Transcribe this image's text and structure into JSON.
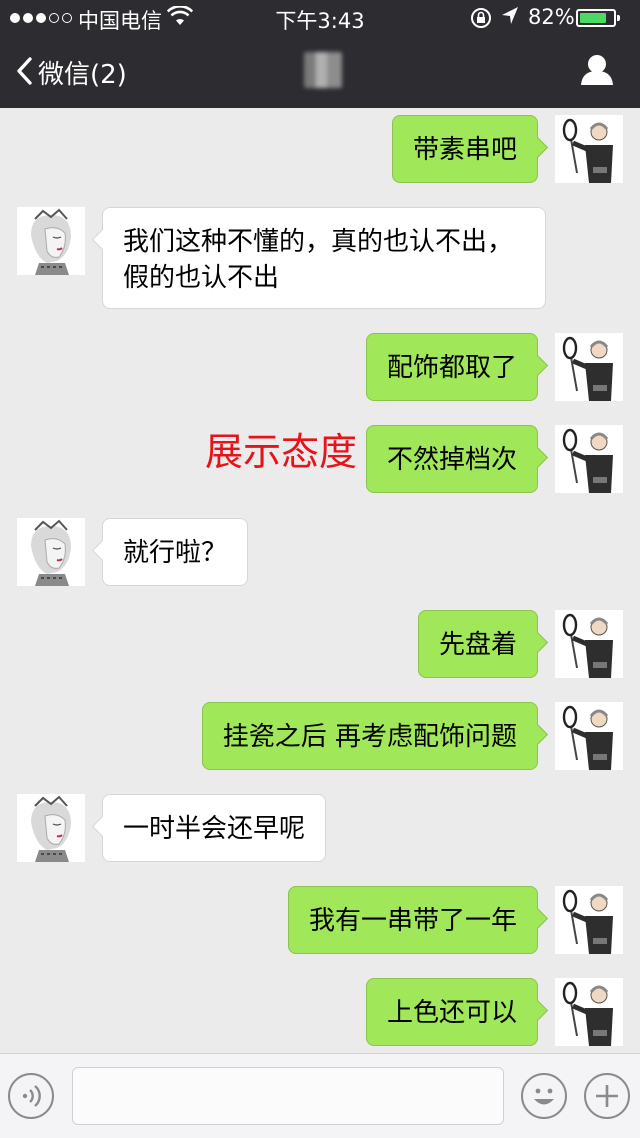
{
  "status_bar": {
    "carrier": "中国电信",
    "time": "下午3:43",
    "battery_percent": "82%",
    "battery_level": 0.82,
    "signal_dots_filled": 3,
    "signal_dots_total": 5
  },
  "nav": {
    "back_label": "微信(2)",
    "title": "",
    "profile_icon": "person-icon"
  },
  "colors": {
    "sent_bubble": "#a0e75a",
    "received_bubble": "#ffffff",
    "annotation": "#e6141a",
    "nav_background": "#2c2c31"
  },
  "messages": [
    {
      "side": "right",
      "text": "带素串吧"
    },
    {
      "side": "left",
      "text": "我们这种不懂的，真的也认不出，\n假的也认不出"
    },
    {
      "side": "right",
      "text": "配饰都取了"
    },
    {
      "side": "right",
      "text": "不然掉档次"
    },
    {
      "side": "left",
      "text": "就行啦？"
    },
    {
      "side": "right",
      "text": "先盘着"
    },
    {
      "side": "right",
      "text": "挂瓷之后 再考虑配饰问题"
    },
    {
      "side": "left",
      "text": "一时半会还早呢"
    },
    {
      "side": "right",
      "text": "我有一串带了一年"
    },
    {
      "side": "right",
      "text": "上色还可以"
    }
  ],
  "annotation": "展示态度",
  "input_bar": {
    "voice_icon": "voice-icon",
    "text_value": "",
    "emoji_icon": "emoji-icon",
    "plus_icon": "plus-icon"
  }
}
